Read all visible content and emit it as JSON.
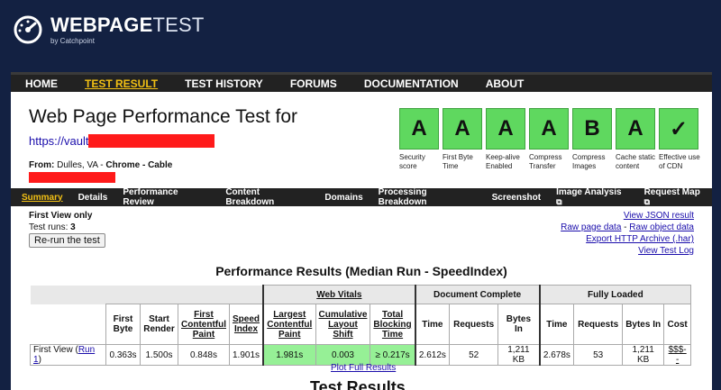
{
  "logo": {
    "word_strong": "WEBPAGE",
    "word_light": "TEST",
    "sub": "by Catchpoint"
  },
  "nav": {
    "items": [
      "HOME",
      "TEST RESULT",
      "TEST HISTORY",
      "FORUMS",
      "DOCUMENTATION",
      "ABOUT"
    ],
    "active": "TEST RESULT"
  },
  "page": {
    "title": "Web Page Performance Test for",
    "url_prefix": "https://vault",
    "from_label": "From:",
    "from_location": " Dulles, VA - ",
    "from_browser": "Chrome - Cable"
  },
  "grades": [
    {
      "grade": "A",
      "label": "Security score"
    },
    {
      "grade": "A",
      "label": "First Byte Time"
    },
    {
      "grade": "A",
      "label": "Keep-alive Enabled"
    },
    {
      "grade": "A",
      "label": "Compress Transfer"
    },
    {
      "grade": "B",
      "label": "Compress Images"
    },
    {
      "grade": "A",
      "label": "Cache static content"
    },
    {
      "grade": "✓",
      "label": "Effective use of CDN"
    }
  ],
  "subnav": {
    "summary": "Summary",
    "details": "Details",
    "performance_review": "Performance Review",
    "content_breakdown": "Content Breakdown",
    "domains": "Domains",
    "processing_breakdown": "Processing Breakdown",
    "screenshot": "Screenshot",
    "image_analysis": "Image Analysis",
    "request_map": "Request Map"
  },
  "run_info": {
    "first_view": "First View only",
    "runs_label": "Test runs: ",
    "runs_value": "3",
    "rerun": "Re-run the test"
  },
  "links": {
    "json": "View JSON result",
    "raw_page": "Raw page data",
    "sep": " - ",
    "raw_object": "Raw object data",
    "har": "Export HTTP Archive (.har)",
    "log": "View Test Log"
  },
  "results_title": "Performance Results (Median Run - SpeedIndex)",
  "table": {
    "groups": {
      "web_vitals": "Web Vitals",
      "doc_complete": "Document Complete",
      "fully_loaded": "Fully Loaded"
    },
    "headers": {
      "first_byte": "First Byte",
      "start_render": "Start Render",
      "fcp": "First Contentful Paint",
      "speed_index": "Speed Index",
      "lcp": "Largest Contentful Paint",
      "cls": "Cumulative Layout Shift",
      "tbt": "Total Blocking Time",
      "time": "Time",
      "requests": "Requests",
      "bytes_in": "Bytes In",
      "cost": "Cost"
    },
    "row": {
      "label": "First View (",
      "run_link": "Run 1",
      "label_end": ")",
      "first_byte": "0.363s",
      "start_render": "1.500s",
      "fcp": "0.848s",
      "speed_index": "1.901s",
      "lcp": "1.981s",
      "cls": "0.003",
      "tbt": "≥ 0.217s",
      "dc_time": "2.612s",
      "dc_requests": "52",
      "dc_bytes": "1,211 KB",
      "fl_time": "2.678s",
      "fl_requests": "53",
      "fl_bytes": "1,211 KB",
      "cost": "$$$--"
    }
  },
  "plot_link": "Plot Full Results",
  "test_results_heading": "Test Results",
  "colors": {
    "grade_green": "#5fd85f",
    "nav_active": "#f2c014",
    "header_bg": "#132142",
    "good_metric": "#96f096"
  }
}
